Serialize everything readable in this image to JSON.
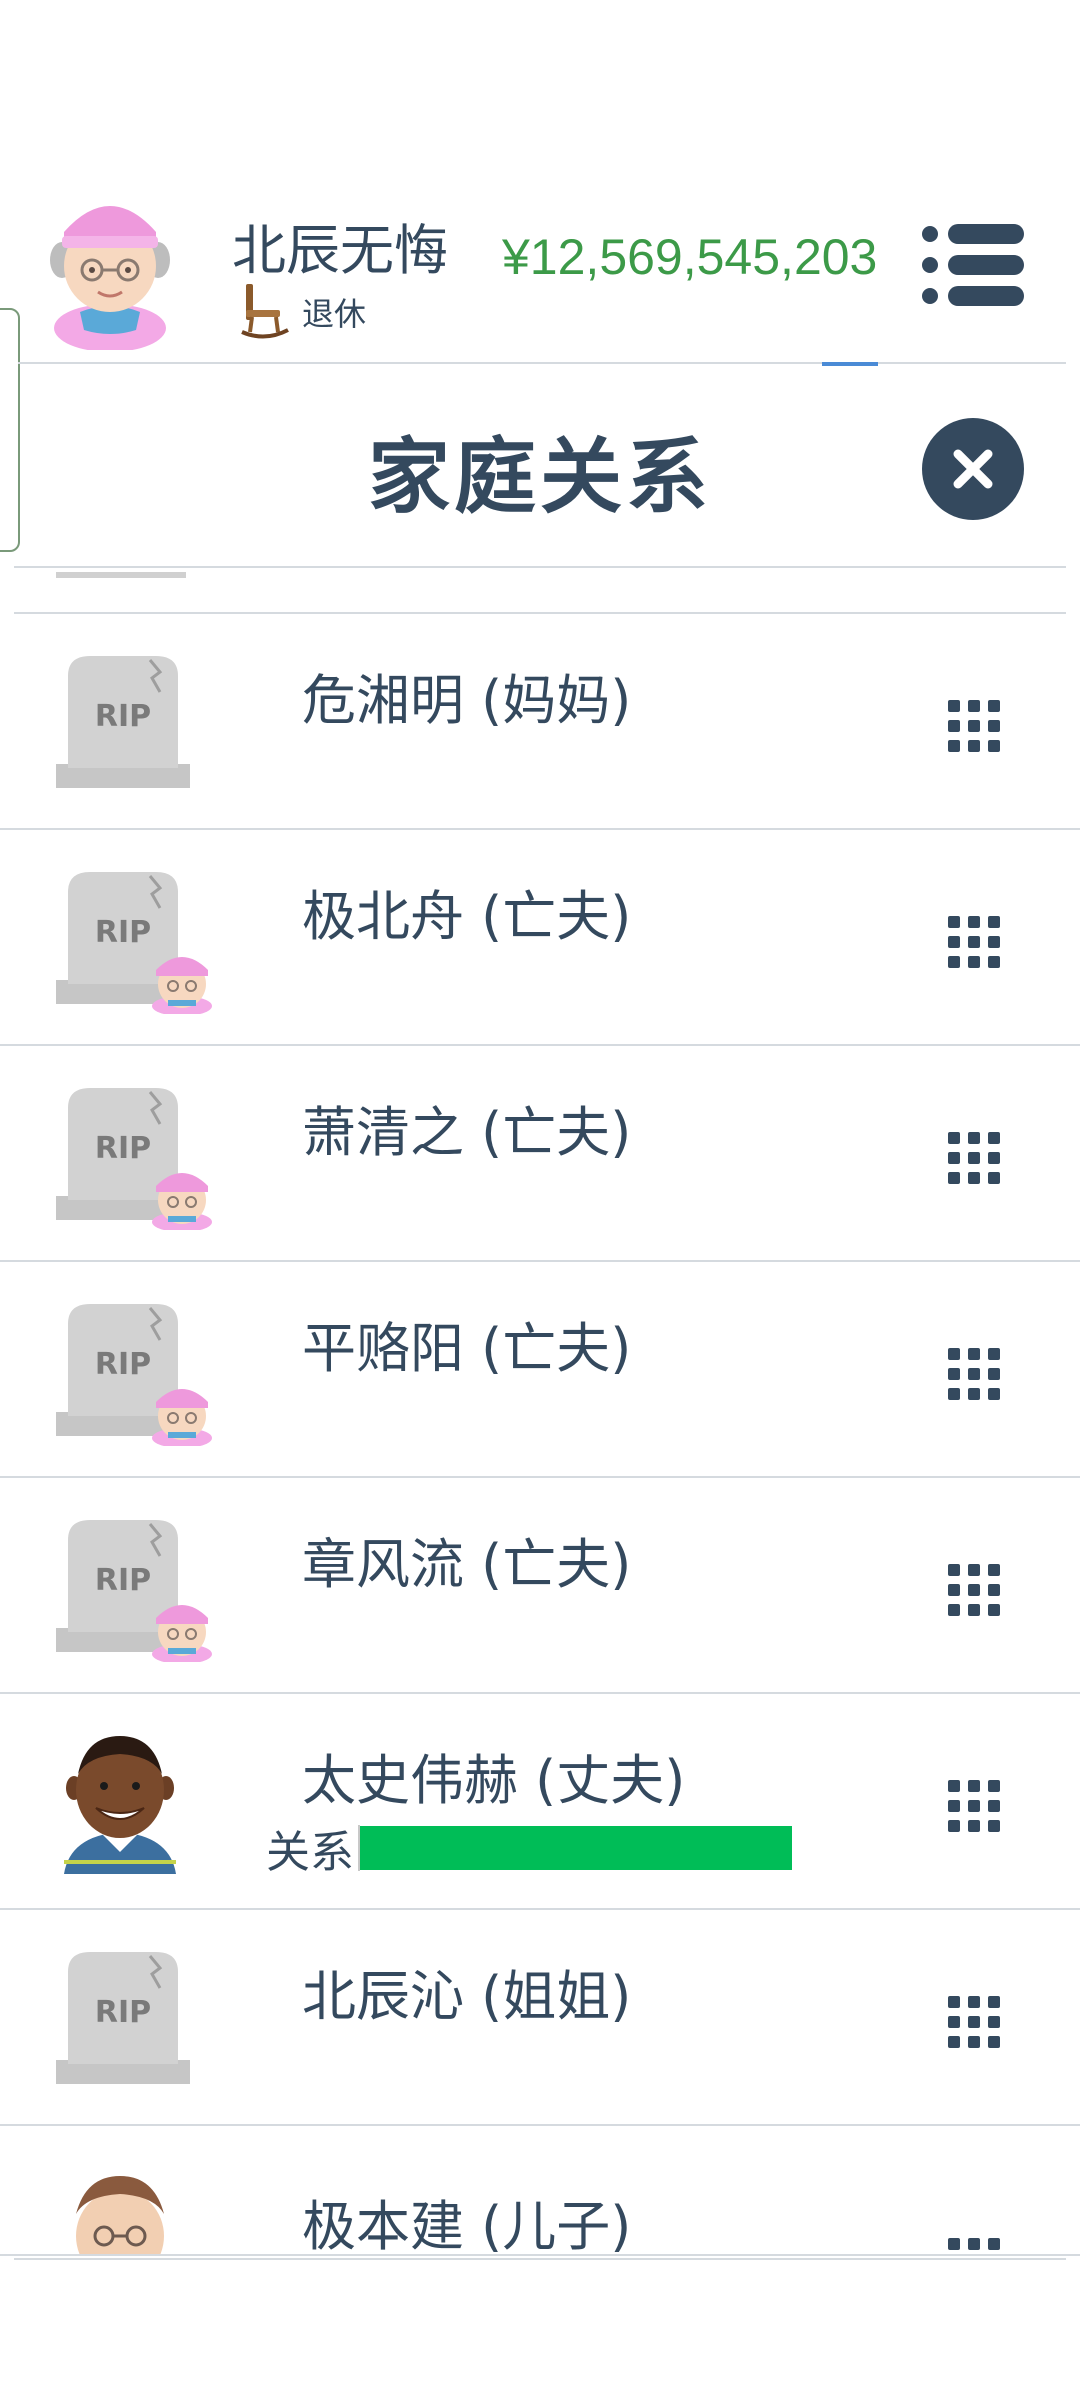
{
  "header": {
    "player_name": "北辰无悔",
    "status": "退休",
    "money": "¥12,569,545,203"
  },
  "panel": {
    "title": "家庭关系"
  },
  "relations": [
    {
      "name": "危湘明 (妈妈)",
      "avatar": "rip",
      "overlay": false,
      "more": "grid"
    },
    {
      "name": "极北舟 (亡夫)",
      "avatar": "rip",
      "overlay": true,
      "more": "grid"
    },
    {
      "name": "萧清之 (亡夫)",
      "avatar": "rip",
      "overlay": true,
      "more": "grid"
    },
    {
      "name": "平赂阳 (亡夫)",
      "avatar": "rip",
      "overlay": true,
      "more": "grid"
    },
    {
      "name": "章风流 (亡夫)",
      "avatar": "rip",
      "overlay": true,
      "more": "grid"
    },
    {
      "name": "太史伟赫 (丈夫)",
      "avatar": "man",
      "relation_label": "关系",
      "relation_level": 1.0,
      "more": "grid"
    },
    {
      "name": "北辰沁 (姐姐)",
      "avatar": "rip",
      "overlay": false,
      "more": "grid"
    },
    {
      "name": "极本建 (儿子)",
      "avatar": "old-man",
      "more": "dots"
    }
  ],
  "tombstone_text": "RIP",
  "colors": {
    "text": "#34495e",
    "money": "#3c9a48",
    "relation_bar": "#00bd57",
    "close_button": "#34495e"
  },
  "icons": {
    "menu": "menu-icon",
    "close": "close-icon",
    "more": "grid-dots-icon",
    "status": "rocking-chair-icon"
  }
}
